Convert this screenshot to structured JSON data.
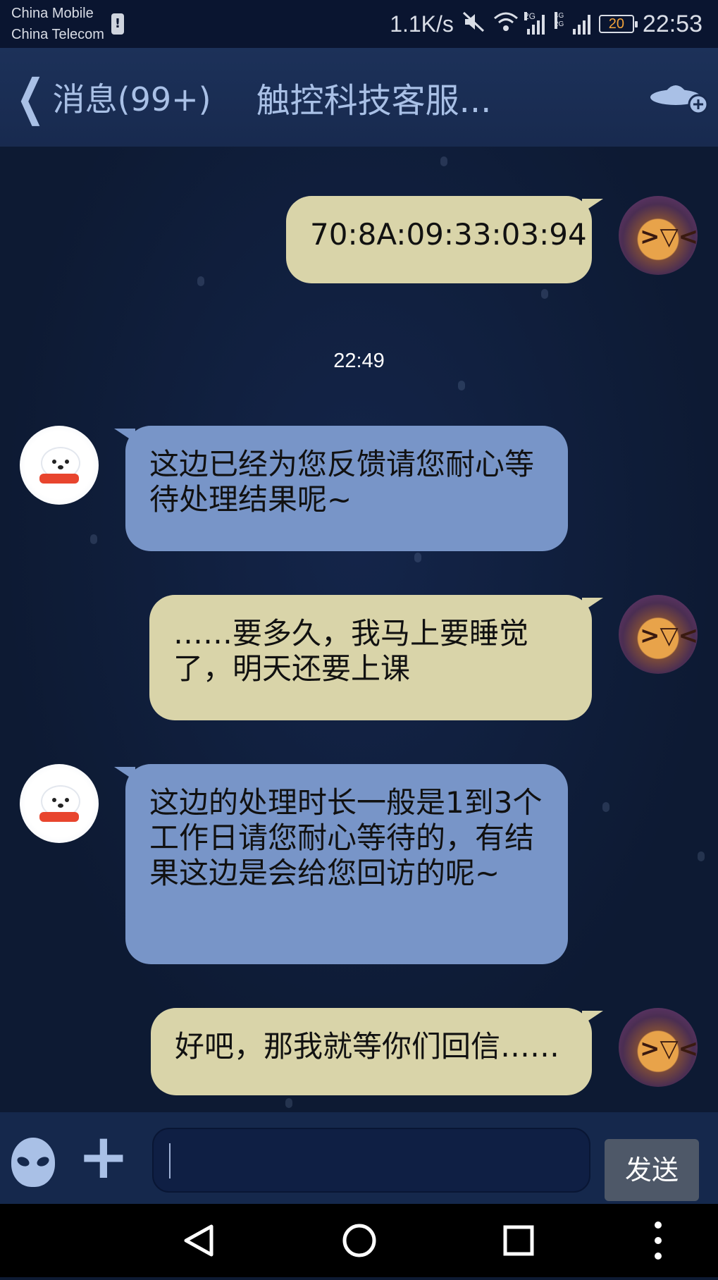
{
  "status_bar": {
    "carrier_1": "China Mobile",
    "carrier_2": "China Telecom",
    "sim_icon": "!",
    "net_speed": "1.1K/s",
    "signal_1_tag": "2G",
    "signal_2_tag": "4G 2G",
    "battery": "20",
    "time": "22:53"
  },
  "header": {
    "back_label": "消息(99+)",
    "title": "触控科技客服...",
    "action_icon": "ufo-add-icon"
  },
  "messages": [
    {
      "sender": "me",
      "text": "70:8A:09:33:03:94"
    },
    {
      "type": "timestamp",
      "text": "22:49"
    },
    {
      "sender": "bot",
      "text": "这边已经为您反馈请您耐心等待处理结果呢~"
    },
    {
      "sender": "me",
      "text": "……要多久，我马上要睡觉了，明天还要上课"
    },
    {
      "sender": "bot",
      "text": "这边的处理时长一般是1到3个工作日请您耐心等待的，有结果这边是会给您回访的呢~"
    },
    {
      "sender": "me",
      "text": "好吧，那我就等你们回信……"
    }
  ],
  "input": {
    "value": "",
    "send_label": "发送"
  },
  "colors": {
    "background": "#0d1a33",
    "header": "#1c3159",
    "bubble_me": "#d9d4a9",
    "bubble_bot": "#7895c8",
    "accent": "#a9c0e6"
  }
}
